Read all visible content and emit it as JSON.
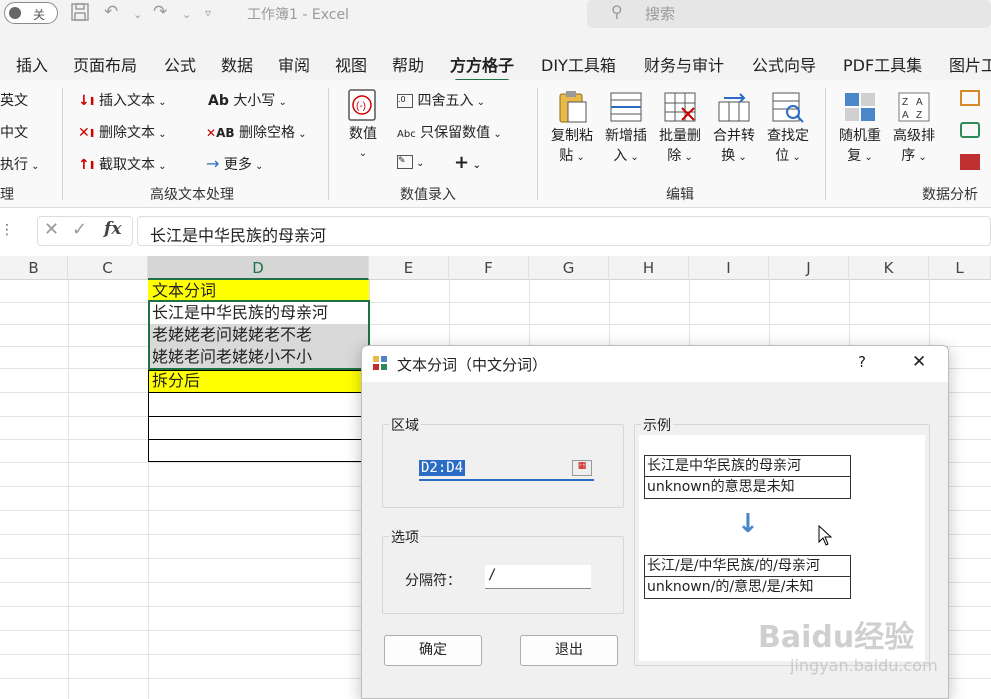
{
  "titlebar": {
    "autosave_label": "关",
    "window_title": "工作簿1  -  Excel",
    "search_placeholder": "搜索"
  },
  "tabs": [
    "插入",
    "页面布局",
    "公式",
    "数据",
    "审阅",
    "视图",
    "帮助",
    "方方格子",
    "DIY工具箱",
    "财务与审计",
    "公式向导",
    "PDF工具集",
    "图片工"
  ],
  "active_tab": "方方格子",
  "ribbon": {
    "left_cut": {
      "item1": "英文",
      "item2": "中文",
      "item3": "执行",
      "group": "理"
    },
    "text_group": {
      "insert_text": "插入文本",
      "delete_text": "删除文本",
      "extract_text": "截取文本",
      "case": "大小写",
      "delete_space": "删除空格",
      "more": "更多",
      "group_label": "高级文本处理"
    },
    "numeric_group": {
      "value": "数值",
      "round": "四舍五入",
      "keep_number": "只保留数值",
      "group_label": "数值录入"
    },
    "edit_group": {
      "copy_paste_1": "复制粘",
      "copy_paste_2": "贴",
      "new_insert_1": "新增插",
      "new_insert_2": "入",
      "batch_delete_1": "批量删",
      "batch_delete_2": "除",
      "merge_convert_1": "合并转",
      "merge_convert_2": "换",
      "find_locate_1": "查找定",
      "find_locate_2": "位",
      "group_label": "编辑"
    },
    "analysis_group": {
      "random_dup_1": "随机重",
      "random_dup_2": "复",
      "advanced_sort_1": "高级排",
      "advanced_sort_2": "序",
      "group_label": "数据分析"
    }
  },
  "formula_bar": {
    "fx": "fx",
    "content": "长江是中华民族的母亲河"
  },
  "columns": [
    "B",
    "C",
    "D",
    "E",
    "F",
    "G",
    "H",
    "I",
    "J",
    "K",
    "L"
  ],
  "cells": {
    "d1": "文本分词",
    "d2": "长江是中华民族的母亲河",
    "d3": "老姥姥老问姥姥老不老",
    "d4": "姥姥老问老姥姥小不小",
    "d5": "拆分后"
  },
  "colors": {
    "yellow": "#ffff00",
    "selected_gray": "#d9d9d9",
    "excel_green": "#1e7145",
    "accent_blue": "#4a86c8"
  },
  "dialog": {
    "title": "文本分词（中文分词）",
    "help": "?",
    "close": "✕",
    "region_label": "区域",
    "region_value": "D2:D4",
    "options_label": "选项",
    "separator_label": "分隔符：",
    "separator_value": "/",
    "ok": "确定",
    "exit": "退出",
    "example_label": "示例",
    "example_before": [
      "长江是中华民族的母亲河",
      "unknown的意思是未知"
    ],
    "example_after": [
      "长江/是/中华民族/的/母亲河",
      "unknown/的/意思/是/未知"
    ]
  },
  "watermark": {
    "brand": "Baidu经验",
    "url": "jingyan.baidu.com"
  }
}
